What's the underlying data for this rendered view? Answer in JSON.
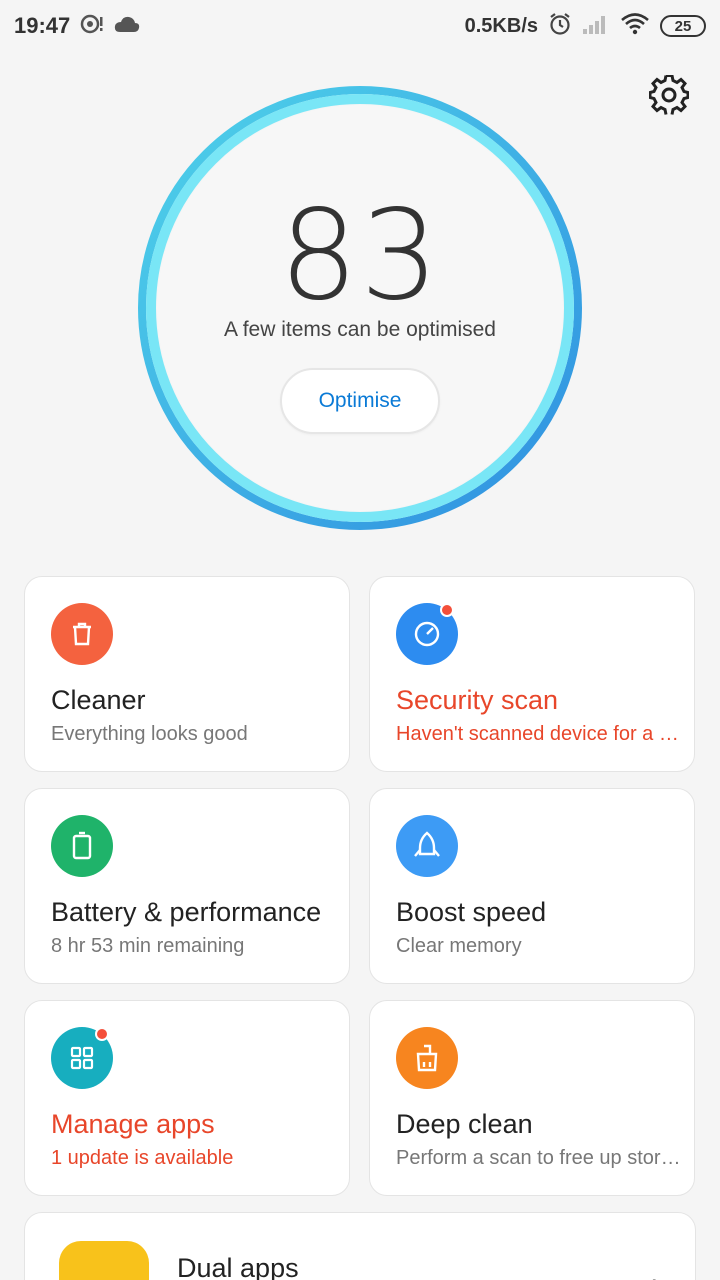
{
  "status_bar": {
    "time": "19:47",
    "speed": "0.5KB/s",
    "battery": "25"
  },
  "header": {
    "settings_icon": "gear-icon"
  },
  "score": {
    "value": "83",
    "caption": "A few items can be optimised",
    "button_label": "Optimise"
  },
  "cards": [
    {
      "title": "Cleaner",
      "subtitle": "Everything looks good",
      "icon": "trash-icon",
      "color": "#f4623f",
      "alert": false
    },
    {
      "title": "Security scan",
      "subtitle": "Haven't scanned device for a while",
      "icon": "shield-scan-icon",
      "color": "#2d8cf0",
      "alert": true
    },
    {
      "title": "Battery & performance",
      "subtitle": "8 hr 53 min  remaining",
      "icon": "battery-icon",
      "color": "#1fb36a",
      "alert": false
    },
    {
      "title": "Boost speed",
      "subtitle": "Clear memory",
      "icon": "rocket-icon",
      "color": "#3d9bf5",
      "alert": false
    },
    {
      "title": "Manage apps",
      "subtitle": "1 update is available",
      "icon": "apps-grid-icon",
      "color": "#17aebf",
      "alert": true
    },
    {
      "title": "Deep clean",
      "subtitle": "Perform a scan to free up storage",
      "icon": "broom-icon",
      "color": "#f7851f",
      "alert": false
    }
  ],
  "dual_apps": {
    "title": "Dual apps",
    "icon": "dual-apps-icon",
    "color": "#f8c21b"
  }
}
